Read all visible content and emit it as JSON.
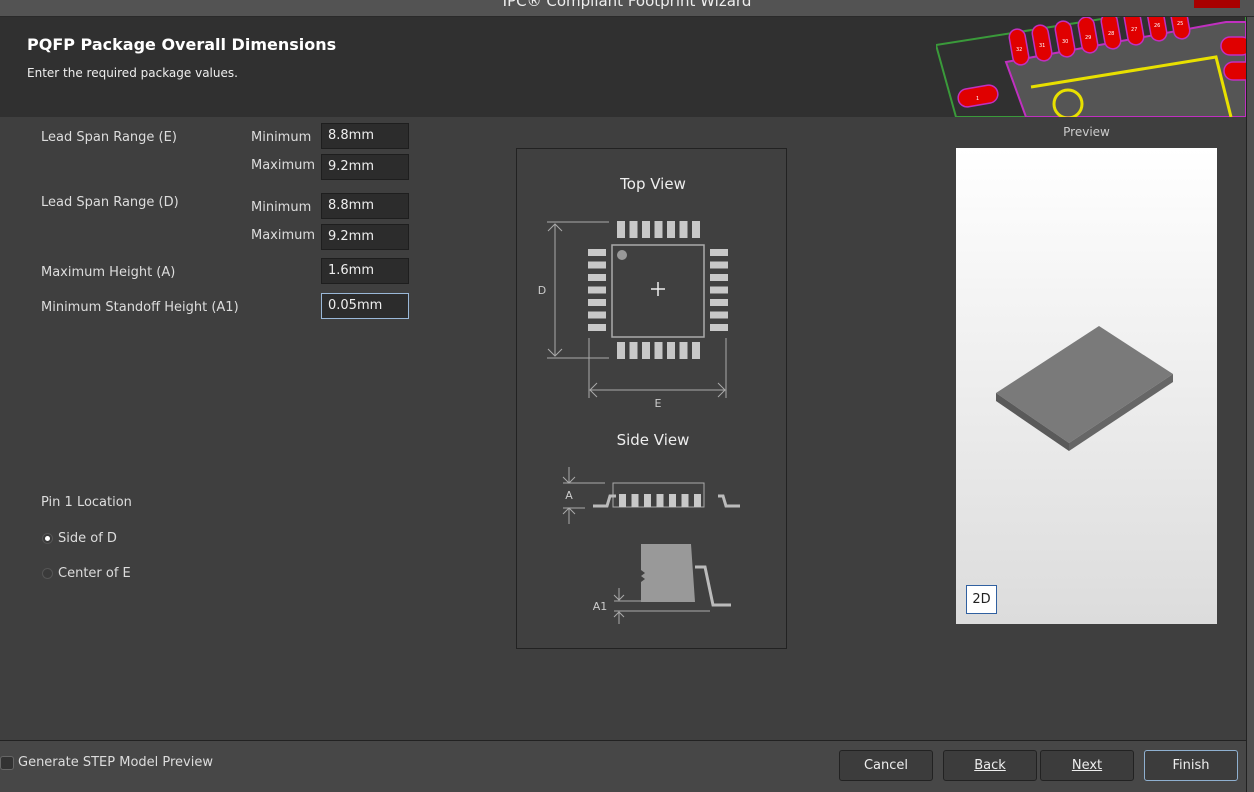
{
  "window": {
    "title": "IPC® Compliant Footprint Wizard"
  },
  "header": {
    "title": "PQFP Package Overall Dimensions",
    "subtitle": "Enter the required package values."
  },
  "fields": {
    "e_label": "Lead Span Range (E)",
    "e_min_label": "Minimum",
    "e_min": "8.8mm",
    "e_max_label": "Maximum",
    "e_max": "9.2mm",
    "d_label": "Lead Span Range (D)",
    "d_min_label": "Minimum",
    "d_min": "8.8mm",
    "d_max_label": "Maximum",
    "d_max": "9.2mm",
    "a_label": "Maximum Height (A)",
    "a": "1.6mm",
    "a1_label": "Minimum Standoff Height (A1)",
    "a1": "0.05mm"
  },
  "pin1": {
    "label": "Pin 1 Location",
    "options": [
      {
        "label": "Side of D",
        "selected": true
      },
      {
        "label": "Center of E",
        "selected": false
      }
    ]
  },
  "diagram": {
    "top_view": "Top View",
    "side_view": "Side View",
    "d": "D",
    "e": "E",
    "a": "A",
    "a1": "A1"
  },
  "preview": {
    "label": "Preview",
    "mode_button": "2D"
  },
  "footer": {
    "step_preview": "Generate STEP Model Preview",
    "step_checked": false,
    "cancel": "Cancel",
    "back": "Back",
    "next": "Next",
    "finish": "Finish"
  },
  "pcb_pad_labels": [
    "32",
    "31",
    "30",
    "29",
    "28",
    "27",
    "26",
    "25",
    "1"
  ],
  "colors": {
    "pad": "#e00000",
    "silk": "#e8e000",
    "outline": "#c030c0"
  }
}
